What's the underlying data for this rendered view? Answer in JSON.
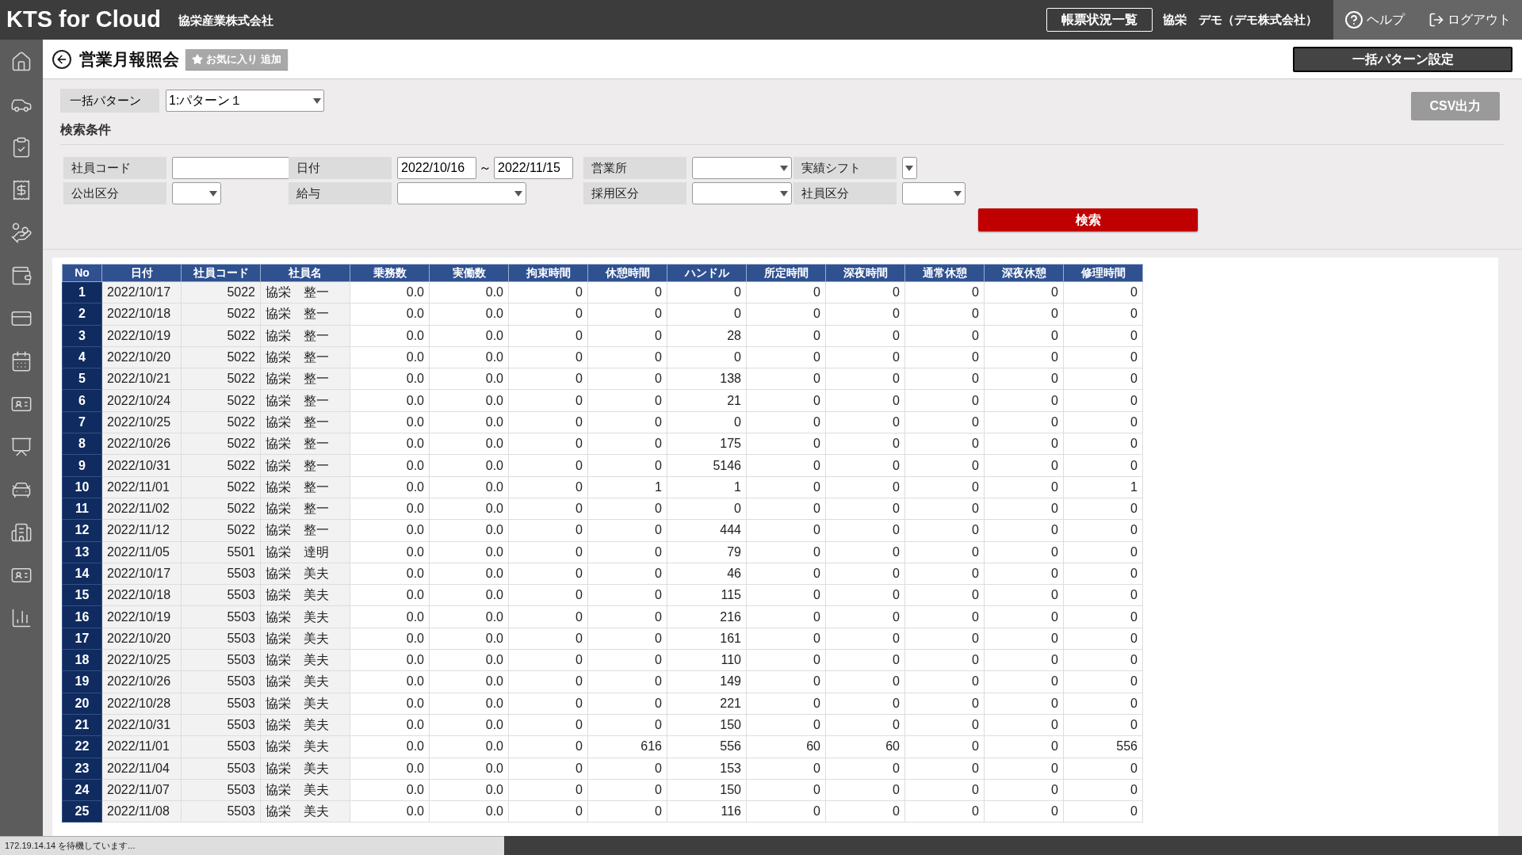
{
  "header": {
    "logo": "KTS for Cloud",
    "company": "協栄産業株式会社",
    "report_button": "帳票状況一覧",
    "user": "協栄　デモ（デモ株式会社）",
    "help": "ヘルプ",
    "logout": "ログアウト"
  },
  "page": {
    "title": "営業月報照会",
    "favorite_button": "お気に入り 追加",
    "pattern_settings_button": "一括パターン設定"
  },
  "pattern": {
    "label": "一括パターン",
    "value": "1:パターン１"
  },
  "csv_button": {
    "label": "CSV出力",
    "disabled": true
  },
  "search": {
    "heading": "検索条件",
    "rows": [
      [
        {
          "kind": "text",
          "label": "社員コード"
        },
        {
          "kind": "date_range",
          "label": "日付",
          "from": "2022/10/16",
          "to": "2022/11/15",
          "separator": "～"
        },
        {
          "kind": "select",
          "label": "営業所"
        },
        {
          "kind": "select",
          "label": "実績シフト"
        }
      ],
      [
        {
          "kind": "select",
          "label": "公出区分"
        },
        {
          "kind": "select",
          "label": "給与"
        },
        {
          "kind": "select",
          "label": "採用区分"
        },
        {
          "kind": "select",
          "label": "社員区分"
        }
      ]
    ],
    "button": "検索"
  },
  "table": {
    "columns": [
      "No",
      "日付",
      "社員コード",
      "社員名",
      "乗務数",
      "実働数",
      "拘束時間",
      "休憩時間",
      "ハンドル",
      "所定時間",
      "深夜時間",
      "通常休憩",
      "深夜休憩",
      "修理時間"
    ],
    "rows": [
      [
        "1",
        "2022/10/17",
        "5022",
        "協栄　整一",
        "0.0",
        "0.0",
        "0",
        "0",
        "0",
        "0",
        "0",
        "0",
        "0",
        "0"
      ],
      [
        "2",
        "2022/10/18",
        "5022",
        "協栄　整一",
        "0.0",
        "0.0",
        "0",
        "0",
        "0",
        "0",
        "0",
        "0",
        "0",
        "0"
      ],
      [
        "3",
        "2022/10/19",
        "5022",
        "協栄　整一",
        "0.0",
        "0.0",
        "0",
        "0",
        "28",
        "0",
        "0",
        "0",
        "0",
        "0"
      ],
      [
        "4",
        "2022/10/20",
        "5022",
        "協栄　整一",
        "0.0",
        "0.0",
        "0",
        "0",
        "0",
        "0",
        "0",
        "0",
        "0",
        "0"
      ],
      [
        "5",
        "2022/10/21",
        "5022",
        "協栄　整一",
        "0.0",
        "0.0",
        "0",
        "0",
        "138",
        "0",
        "0",
        "0",
        "0",
        "0"
      ],
      [
        "6",
        "2022/10/24",
        "5022",
        "協栄　整一",
        "0.0",
        "0.0",
        "0",
        "0",
        "21",
        "0",
        "0",
        "0",
        "0",
        "0"
      ],
      [
        "7",
        "2022/10/25",
        "5022",
        "協栄　整一",
        "0.0",
        "0.0",
        "0",
        "0",
        "0",
        "0",
        "0",
        "0",
        "0",
        "0"
      ],
      [
        "8",
        "2022/10/26",
        "5022",
        "協栄　整一",
        "0.0",
        "0.0",
        "0",
        "0",
        "175",
        "0",
        "0",
        "0",
        "0",
        "0"
      ],
      [
        "9",
        "2022/10/31",
        "5022",
        "協栄　整一",
        "0.0",
        "0.0",
        "0",
        "0",
        "5146",
        "0",
        "0",
        "0",
        "0",
        "0"
      ],
      [
        "10",
        "2022/11/01",
        "5022",
        "協栄　整一",
        "0.0",
        "0.0",
        "0",
        "1",
        "1",
        "0",
        "0",
        "0",
        "0",
        "1"
      ],
      [
        "11",
        "2022/11/02",
        "5022",
        "協栄　整一",
        "0.0",
        "0.0",
        "0",
        "0",
        "0",
        "0",
        "0",
        "0",
        "0",
        "0"
      ],
      [
        "12",
        "2022/11/12",
        "5022",
        "協栄　整一",
        "0.0",
        "0.0",
        "0",
        "0",
        "444",
        "0",
        "0",
        "0",
        "0",
        "0"
      ],
      [
        "13",
        "2022/11/05",
        "5501",
        "協栄　達明",
        "0.0",
        "0.0",
        "0",
        "0",
        "79",
        "0",
        "0",
        "0",
        "0",
        "0"
      ],
      [
        "14",
        "2022/10/17",
        "5503",
        "協栄　美夫",
        "0.0",
        "0.0",
        "0",
        "0",
        "46",
        "0",
        "0",
        "0",
        "0",
        "0"
      ],
      [
        "15",
        "2022/10/18",
        "5503",
        "協栄　美夫",
        "0.0",
        "0.0",
        "0",
        "0",
        "115",
        "0",
        "0",
        "0",
        "0",
        "0"
      ],
      [
        "16",
        "2022/10/19",
        "5503",
        "協栄　美夫",
        "0.0",
        "0.0",
        "0",
        "0",
        "216",
        "0",
        "0",
        "0",
        "0",
        "0"
      ],
      [
        "17",
        "2022/10/20",
        "5503",
        "協栄　美夫",
        "0.0",
        "0.0",
        "0",
        "0",
        "161",
        "0",
        "0",
        "0",
        "0",
        "0"
      ],
      [
        "18",
        "2022/10/25",
        "5503",
        "協栄　美夫",
        "0.0",
        "0.0",
        "0",
        "0",
        "110",
        "0",
        "0",
        "0",
        "0",
        "0"
      ],
      [
        "19",
        "2022/10/26",
        "5503",
        "協栄　美夫",
        "0.0",
        "0.0",
        "0",
        "0",
        "149",
        "0",
        "0",
        "0",
        "0",
        "0"
      ],
      [
        "20",
        "2022/10/28",
        "5503",
        "協栄　美夫",
        "0.0",
        "0.0",
        "0",
        "0",
        "221",
        "0",
        "0",
        "0",
        "0",
        "0"
      ],
      [
        "21",
        "2022/10/31",
        "5503",
        "協栄　美夫",
        "0.0",
        "0.0",
        "0",
        "0",
        "150",
        "0",
        "0",
        "0",
        "0",
        "0"
      ],
      [
        "22",
        "2022/11/01",
        "5503",
        "協栄　美夫",
        "0.0",
        "0.0",
        "0",
        "616",
        "556",
        "60",
        "60",
        "0",
        "0",
        "556"
      ],
      [
        "23",
        "2022/11/04",
        "5503",
        "協栄　美夫",
        "0.0",
        "0.0",
        "0",
        "0",
        "153",
        "0",
        "0",
        "0",
        "0",
        "0"
      ],
      [
        "24",
        "2022/11/07",
        "5503",
        "協栄　美夫",
        "0.0",
        "0.0",
        "0",
        "0",
        "150",
        "0",
        "0",
        "0",
        "0",
        "0"
      ],
      [
        "25",
        "2022/11/08",
        "5503",
        "協栄　美夫",
        "0.0",
        "0.0",
        "0",
        "0",
        "116",
        "0",
        "0",
        "0",
        "0",
        "0"
      ]
    ]
  },
  "status_bar": {
    "text": "172.19.14.14 を待機しています..."
  }
}
